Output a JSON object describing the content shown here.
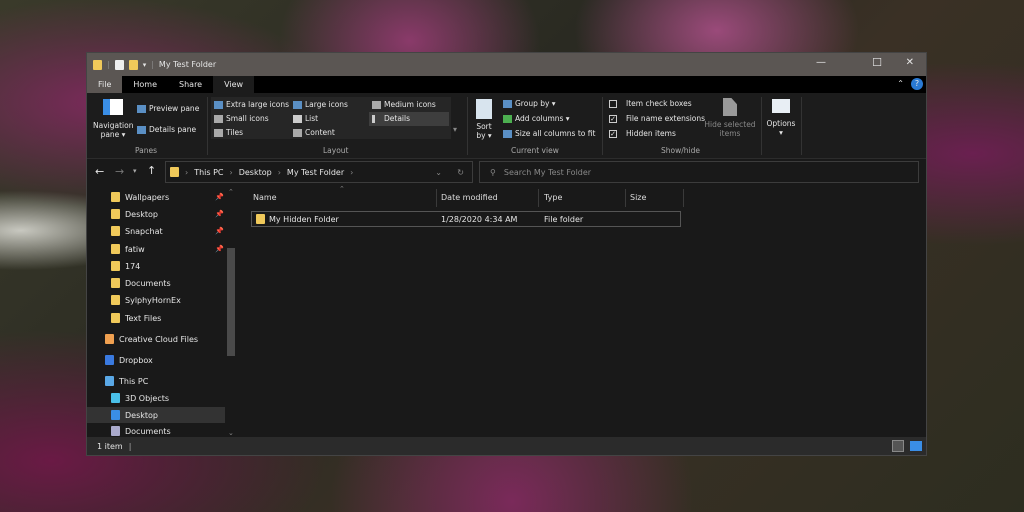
{
  "window": {
    "title": "My Test Folder",
    "minimize": "—",
    "maximize": "☐",
    "close": "✕"
  },
  "tabs": [
    {
      "label": "File"
    },
    {
      "label": "Home"
    },
    {
      "label": "Share"
    },
    {
      "label": "View"
    }
  ],
  "ribbon": {
    "panes": {
      "navigation_pane": "Navigation pane ▾",
      "preview_pane": "Preview pane",
      "details_pane": "Details pane",
      "group": "Panes"
    },
    "layout": {
      "items": [
        "Extra large icons",
        "Large icons",
        "Medium icons",
        "Small icons",
        "List",
        "Details",
        "Tiles",
        "Content"
      ],
      "selected": "Details",
      "group": "Layout"
    },
    "current_view": {
      "sort_by": "Sort by ▾",
      "group_by": "Group by ▾",
      "add_columns": "Add columns ▾",
      "size_all": "Size all columns to fit",
      "group": "Current view"
    },
    "show_hide": {
      "item_check_boxes": "Item check boxes",
      "item_check_boxes_checked": false,
      "file_name_extensions": "File name extensions",
      "file_name_extensions_checked": true,
      "hidden_items": "Hidden items",
      "hidden_items_checked": true,
      "hide_selected": "Hide selected items",
      "group": "Show/hide"
    },
    "options": "Options ▾"
  },
  "address": {
    "path": [
      "This PC",
      "Desktop",
      "My Test Folder"
    ]
  },
  "search": {
    "placeholder": "Search My Test Folder"
  },
  "nav": {
    "quick_access": [
      "Wallpapers",
      "Desktop",
      "Snapchat",
      "fatiw",
      "174",
      "Documents",
      "SylphyHornEx",
      "Text Files"
    ],
    "creative_cloud": "Creative Cloud Files",
    "dropbox": "Dropbox",
    "this_pc": "This PC",
    "pc_items": [
      "3D Objects",
      "Desktop",
      "Documents"
    ]
  },
  "columns": [
    "Name",
    "Date modified",
    "Type",
    "Size"
  ],
  "files": [
    {
      "name": "My Hidden Folder",
      "date": "1/28/2020 4:34 AM",
      "type": "File folder",
      "size": ""
    }
  ],
  "status": {
    "count": "1 item"
  }
}
